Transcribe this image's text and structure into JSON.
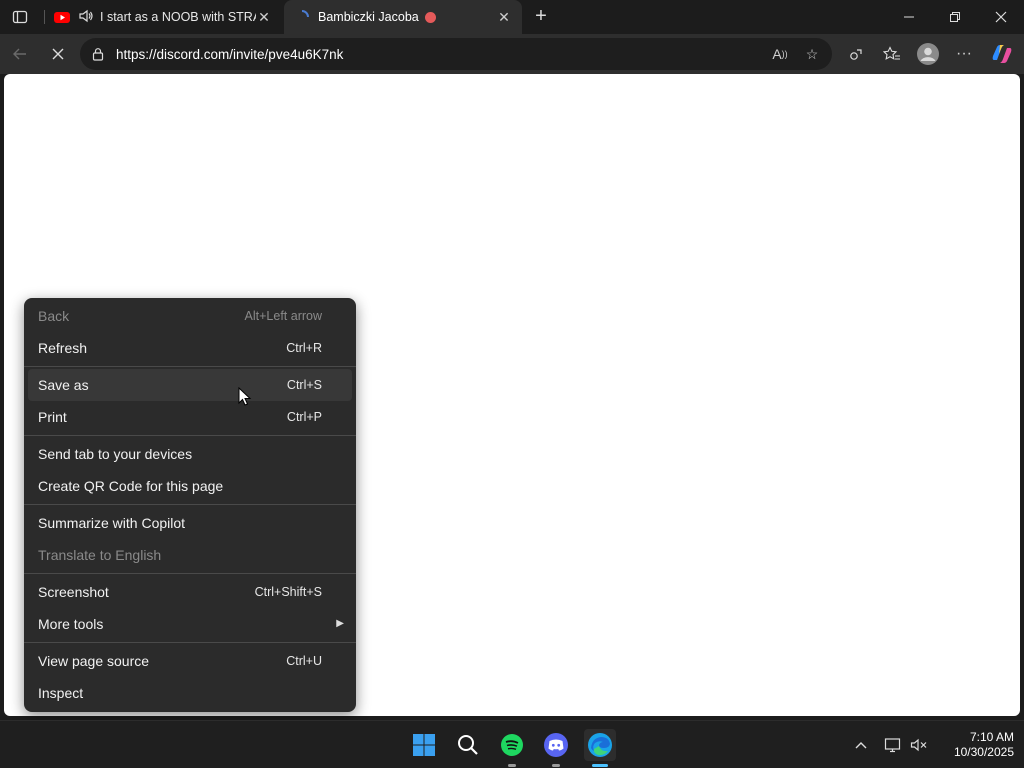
{
  "browser": {
    "tabs": [
      {
        "title": "I start as a NOOB with STRAW",
        "active": false
      },
      {
        "title": "Bambiczki Jacoba",
        "active": true
      }
    ],
    "url": "https://discord.com/invite/pve4u6K7nk"
  },
  "context_menu": {
    "items": [
      {
        "label": "Back",
        "shortcut": "Alt+Left arrow",
        "disabled": true
      },
      {
        "label": "Refresh",
        "shortcut": "Ctrl+R"
      },
      {
        "label": "Save as",
        "shortcut": "Ctrl+S"
      },
      {
        "label": "Print",
        "shortcut": "Ctrl+P"
      },
      {
        "label": "Send tab to your devices",
        "shortcut": ""
      },
      {
        "label": "Create QR Code for this page",
        "shortcut": ""
      },
      {
        "label": "Summarize with Copilot",
        "shortcut": ""
      },
      {
        "label": "Translate to English",
        "shortcut": "",
        "disabled": true
      },
      {
        "label": "Screenshot",
        "shortcut": "Ctrl+Shift+S"
      },
      {
        "label": "More tools",
        "shortcut": ""
      },
      {
        "label": "View page source",
        "shortcut": "Ctrl+U"
      },
      {
        "label": "Inspect",
        "shortcut": ""
      }
    ]
  },
  "taskbar": {
    "time": "7:10 AM",
    "date": "10/30/2025"
  },
  "colors": {
    "accent": "#4cc2ff",
    "youtube_red": "#ff0000",
    "spotify_green": "#1ed760",
    "discord_blurple": "#5865f2"
  }
}
